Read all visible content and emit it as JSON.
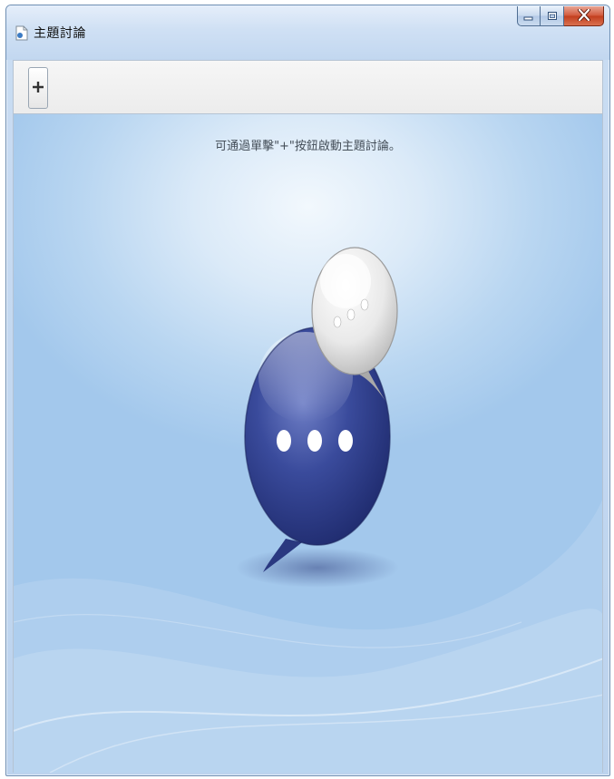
{
  "window": {
    "title": "主題討論",
    "controls": {
      "minimize_icon": "minimize-icon",
      "maximize_icon": "maximize-icon",
      "close_icon": "close-icon"
    }
  },
  "toolbar": {
    "add_button_label": "+"
  },
  "main": {
    "hint_text": "可通過單擊\"+\"按鈕啟動主題討論。",
    "illustration_icon": "chat-bubbles-icon"
  },
  "colors": {
    "titlebar": "#cfe0f4",
    "content_bg": "#b9d6f1",
    "close_button": "#c23d1d",
    "bubble_blue": "#2d3f8e",
    "bubble_white": "#f4f4f4"
  }
}
